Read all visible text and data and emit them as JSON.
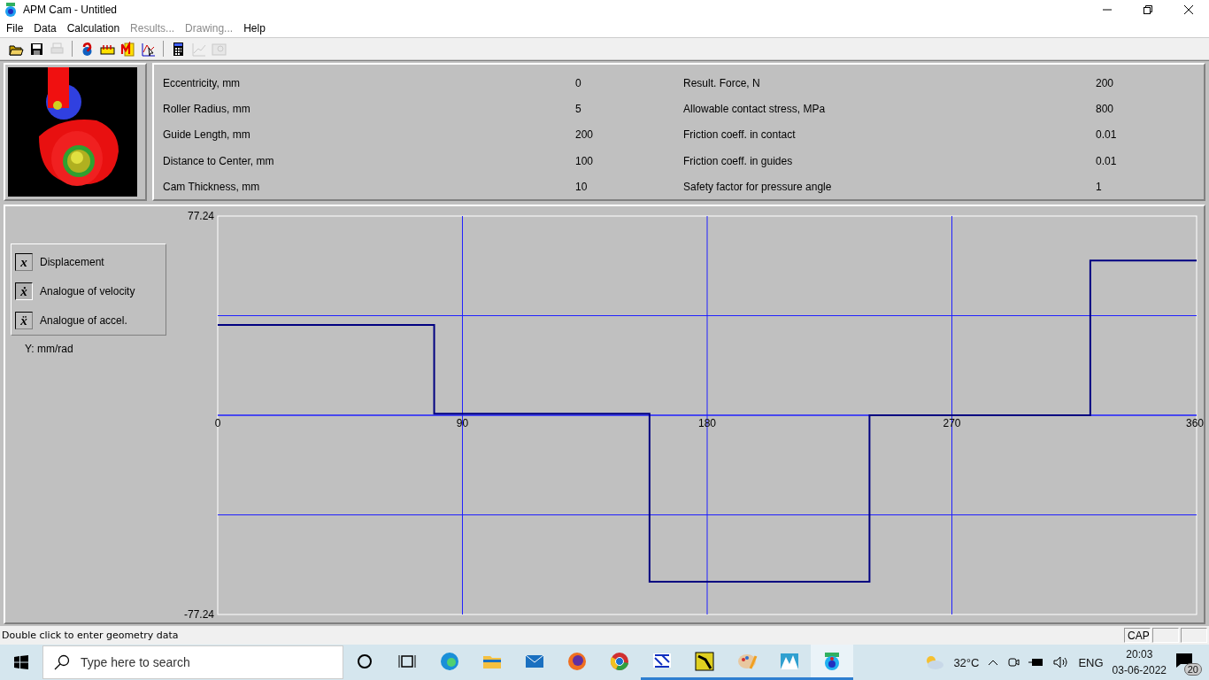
{
  "window": {
    "title": "APM Cam - Untitled"
  },
  "menu": [
    {
      "label": "File",
      "disabled": false
    },
    {
      "label": "Data",
      "disabled": false
    },
    {
      "label": "Calculation",
      "disabled": false
    },
    {
      "label": "Results...",
      "disabled": true
    },
    {
      "label": "Drawing...",
      "disabled": true
    },
    {
      "label": "Help",
      "disabled": false
    }
  ],
  "toolbar": [
    [
      {
        "disabled": false
      },
      {
        "disabled": false
      },
      {
        "disabled": true
      }
    ],
    [
      {
        "disabled": false
      },
      {
        "disabled": false
      },
      {
        "disabled": false
      },
      {
        "disabled": false
      }
    ],
    [
      {
        "disabled": false
      },
      {
        "disabled": true
      },
      {
        "disabled": true
      }
    ]
  ],
  "parameters": [
    [
      {
        "label": "Eccentricity, mm",
        "value": "0"
      },
      {
        "label": "Roller Radius, mm",
        "value": "5"
      },
      {
        "label": "Guide Length, mm",
        "value": "200"
      },
      {
        "label": "Distance to Center, mm",
        "value": "100"
      },
      {
        "label": "Cam Thickness, mm",
        "value": "10"
      }
    ],
    [
      {
        "label": "Result. Force, N",
        "value": "200"
      },
      {
        "label": "Allowable contact stress, MPa",
        "value": "800"
      },
      {
        "label": "Friction coeff. in contact",
        "value": "0.01"
      },
      {
        "label": "Friction coeff. in guides",
        "value": "0.01"
      },
      {
        "label": "Safety factor for pressure angle",
        "value": "1"
      }
    ]
  ],
  "legend": [
    {
      "symbol": "x",
      "label": "Displacement",
      "selected": false
    },
    {
      "symbol": "ẋ",
      "label": "Analogue of velocity",
      "selected": true
    },
    {
      "symbol": "ẍ",
      "label": "Analogue of accel.",
      "selected": false
    }
  ],
  "y_unit": "Y: mm/rad",
  "chart_data": {
    "type": "line",
    "x": [
      0,
      79.6,
      79.6,
      158.8,
      158.8,
      239.7,
      239.7,
      320.9,
      320.9,
      360
    ],
    "series": [
      {
        "color": "#000080",
        "values": [
          35,
          35,
          0.6,
          0.6,
          -64.5,
          -64.5,
          0,
          0,
          60,
          60
        ]
      }
    ],
    "grid": true,
    "xlim": [
      0,
      360
    ],
    "ylim": [
      -77.24,
      77.24
    ],
    "xticks": [
      0,
      90,
      180,
      270,
      360
    ],
    "yticks": [
      {
        "value": -77.24,
        "label": "-77.24"
      },
      {
        "value": 77.24,
        "label": "77.24"
      }
    ]
  },
  "status_bar": {
    "message": "Double click to enter geometry data",
    "indicators": [
      "CAP"
    ]
  },
  "taskbar": {
    "search_placeholder": "Type here to search",
    "apps": [
      {
        "running": false,
        "selected": false
      },
      {
        "running": false,
        "selected": false
      },
      {
        "running": false,
        "selected": false
      },
      {
        "running": false,
        "selected": false
      },
      {
        "running": false,
        "selected": false
      },
      {
        "running": false,
        "selected": false
      },
      {
        "running": false,
        "selected": false
      },
      {
        "running": true,
        "selected": false
      },
      {
        "running": true,
        "selected": false
      },
      {
        "running": true,
        "selected": false
      },
      {
        "running": true,
        "selected": false
      },
      {
        "running": true,
        "selected": true
      }
    ],
    "temperature": "32°C",
    "language": "ENG",
    "time": "20:03",
    "date": "03-06-2022",
    "notifications": "20"
  }
}
